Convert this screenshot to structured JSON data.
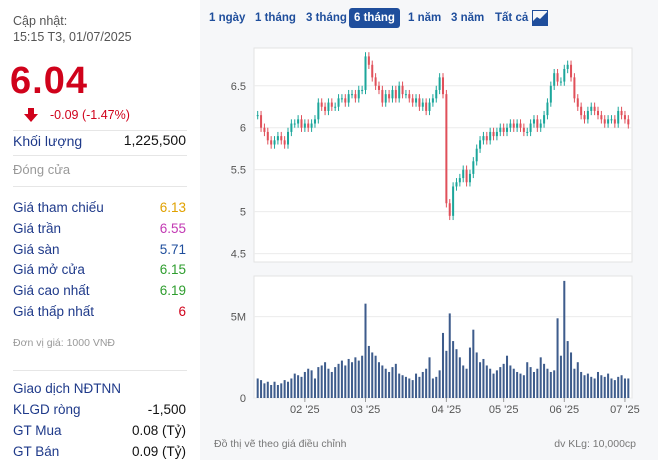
{
  "header": {
    "updated_label": "Cập nhật:",
    "updated_time": "15:15 T3, 01/07/2025",
    "price": "6.04",
    "change": "-0.09 (-1.47%)",
    "colors": {
      "down": "#d0021b",
      "up": "#2e9d2e",
      "ref": "#e0a100",
      "floor": "#1f4e9c",
      "ceil": "#c239b3"
    }
  },
  "volume": {
    "label": "Khối lượng",
    "value": "1,225,500"
  },
  "closing_label": "Đóng cửa",
  "stats": [
    {
      "label": "Giá tham chiếu",
      "value": "6.13",
      "color": "#e0a100"
    },
    {
      "label": "Giá trần",
      "value": "6.55",
      "color": "#c239b3"
    },
    {
      "label": "Giá sàn",
      "value": "5.71",
      "color": "#1f4e9c"
    },
    {
      "label": "Giá mở cửa",
      "value": "6.15",
      "color": "#2e9d2e"
    },
    {
      "label": "Giá cao nhất",
      "value": "6.19",
      "color": "#2e9d2e"
    },
    {
      "label": "Giá thấp nhất",
      "value": "6",
      "color": "#d0021b"
    }
  ],
  "unit_note": "Đơn vị giá: 1000 VNĐ",
  "foreign": {
    "title": "Giao dịch NĐTNN",
    "rows": [
      {
        "label": "KLGD ròng",
        "value": "-1,500"
      },
      {
        "label": "GT Mua",
        "value": "0.08 (Tỷ)"
      },
      {
        "label": "GT Bán",
        "value": "0.09 (Tỷ)"
      }
    ]
  },
  "tabs": [
    {
      "label": "1 ngày",
      "active": false
    },
    {
      "label": "1 tháng",
      "active": false
    },
    {
      "label": "3 tháng",
      "active": false
    },
    {
      "label": "6 tháng",
      "active": true
    },
    {
      "label": "1 năm",
      "active": false
    },
    {
      "label": "3 năm",
      "active": false
    },
    {
      "label": "Tất cả",
      "active": false
    }
  ],
  "chart_icon": "area-chart-icon",
  "footer": {
    "left": "Đồ thị vẽ theo giá điều chỉnh",
    "right": "dv KLg: 10,000cp"
  },
  "chart_data": {
    "type": "candlestick",
    "price_ticks": [
      "6.5",
      "6",
      "5.5",
      "5",
      "4.5"
    ],
    "price_tick_values": [
      6.5,
      6.0,
      5.5,
      5.0,
      4.5
    ],
    "price_range": [
      4.4,
      6.95
    ],
    "volume_ticks": [
      "5M",
      "0"
    ],
    "volume_tick_values": [
      5000000,
      0
    ],
    "volume_range": [
      0,
      7500000
    ],
    "x_labels": [
      "02 '25",
      "03 '25",
      "04 '25",
      "05 '25",
      "06 '25",
      "07 '25"
    ],
    "x_label_index": [
      14,
      32,
      56,
      73,
      91,
      109
    ],
    "closes": [
      6.15,
      6.0,
      5.95,
      5.85,
      5.8,
      5.85,
      5.9,
      5.85,
      5.8,
      5.95,
      6.05,
      6.05,
      6.1,
      6.0,
      6.05,
      6.0,
      6.05,
      6.1,
      6.3,
      6.25,
      6.2,
      6.3,
      6.25,
      6.25,
      6.35,
      6.35,
      6.3,
      6.4,
      6.4,
      6.35,
      6.45,
      6.45,
      6.85,
      6.75,
      6.6,
      6.5,
      6.45,
      6.3,
      6.4,
      6.35,
      6.45,
      6.35,
      6.5,
      6.4,
      6.4,
      6.35,
      6.3,
      6.35,
      6.25,
      6.3,
      6.2,
      6.3,
      6.35,
      6.45,
      6.6,
      6.4,
      5.1,
      4.95,
      5.3,
      5.35,
      5.4,
      5.5,
      5.35,
      5.45,
      5.6,
      5.75,
      5.85,
      5.9,
      5.85,
      5.95,
      5.9,
      5.95,
      6.0,
      5.95,
      6.0,
      6.05,
      6.0,
      6.05,
      6.0,
      5.95,
      5.95,
      6.05,
      6.1,
      6.0,
      6.05,
      6.15,
      6.3,
      6.5,
      6.65,
      6.55,
      6.55,
      6.7,
      6.75,
      6.6,
      6.35,
      6.25,
      6.15,
      6.1,
      6.2,
      6.25,
      6.2,
      6.15,
      6.1,
      6.05,
      6.1,
      6.1,
      6.05,
      6.2,
      6.15,
      6.1,
      6.04
    ],
    "volumes": [
      1.2,
      1.1,
      0.9,
      1.0,
      0.8,
      1.0,
      0.8,
      0.9,
      1.1,
      1.0,
      1.2,
      1.5,
      1.4,
      1.3,
      1.6,
      1.8,
      1.7,
      1.2,
      1.9,
      2.0,
      2.2,
      1.8,
      1.6,
      1.9,
      2.1,
      2.3,
      2.0,
      2.4,
      2.2,
      2.5,
      2.3,
      2.6,
      5.8,
      3.2,
      2.8,
      2.6,
      2.2,
      2.0,
      1.8,
      1.6,
      1.9,
      2.1,
      1.5,
      1.4,
      1.3,
      1.2,
      1.1,
      1.5,
      1.3,
      1.6,
      1.8,
      2.5,
      1.2,
      1.3,
      1.7,
      4.0,
      2.9,
      5.2,
      3.5,
      3.0,
      2.5,
      2.0,
      1.8,
      3.1,
      4.2,
      2.8,
      2.2,
      2.4,
      2.0,
      1.8,
      1.5,
      1.7,
      1.9,
      2.1,
      2.6,
      2.0,
      1.8,
      1.6,
      1.5,
      1.4,
      2.2,
      1.9,
      1.6,
      1.8,
      2.5,
      2.1,
      1.8,
      1.6,
      1.7,
      4.9,
      2.6,
      7.2,
      3.5,
      2.8,
      1.8,
      2.2,
      1.6,
      1.4,
      1.5,
      1.3,
      1.2,
      1.6,
      1.4,
      1.3,
      1.5,
      1.2,
      1.1,
      1.3,
      1.4,
      1.2,
      1.2
    ]
  }
}
